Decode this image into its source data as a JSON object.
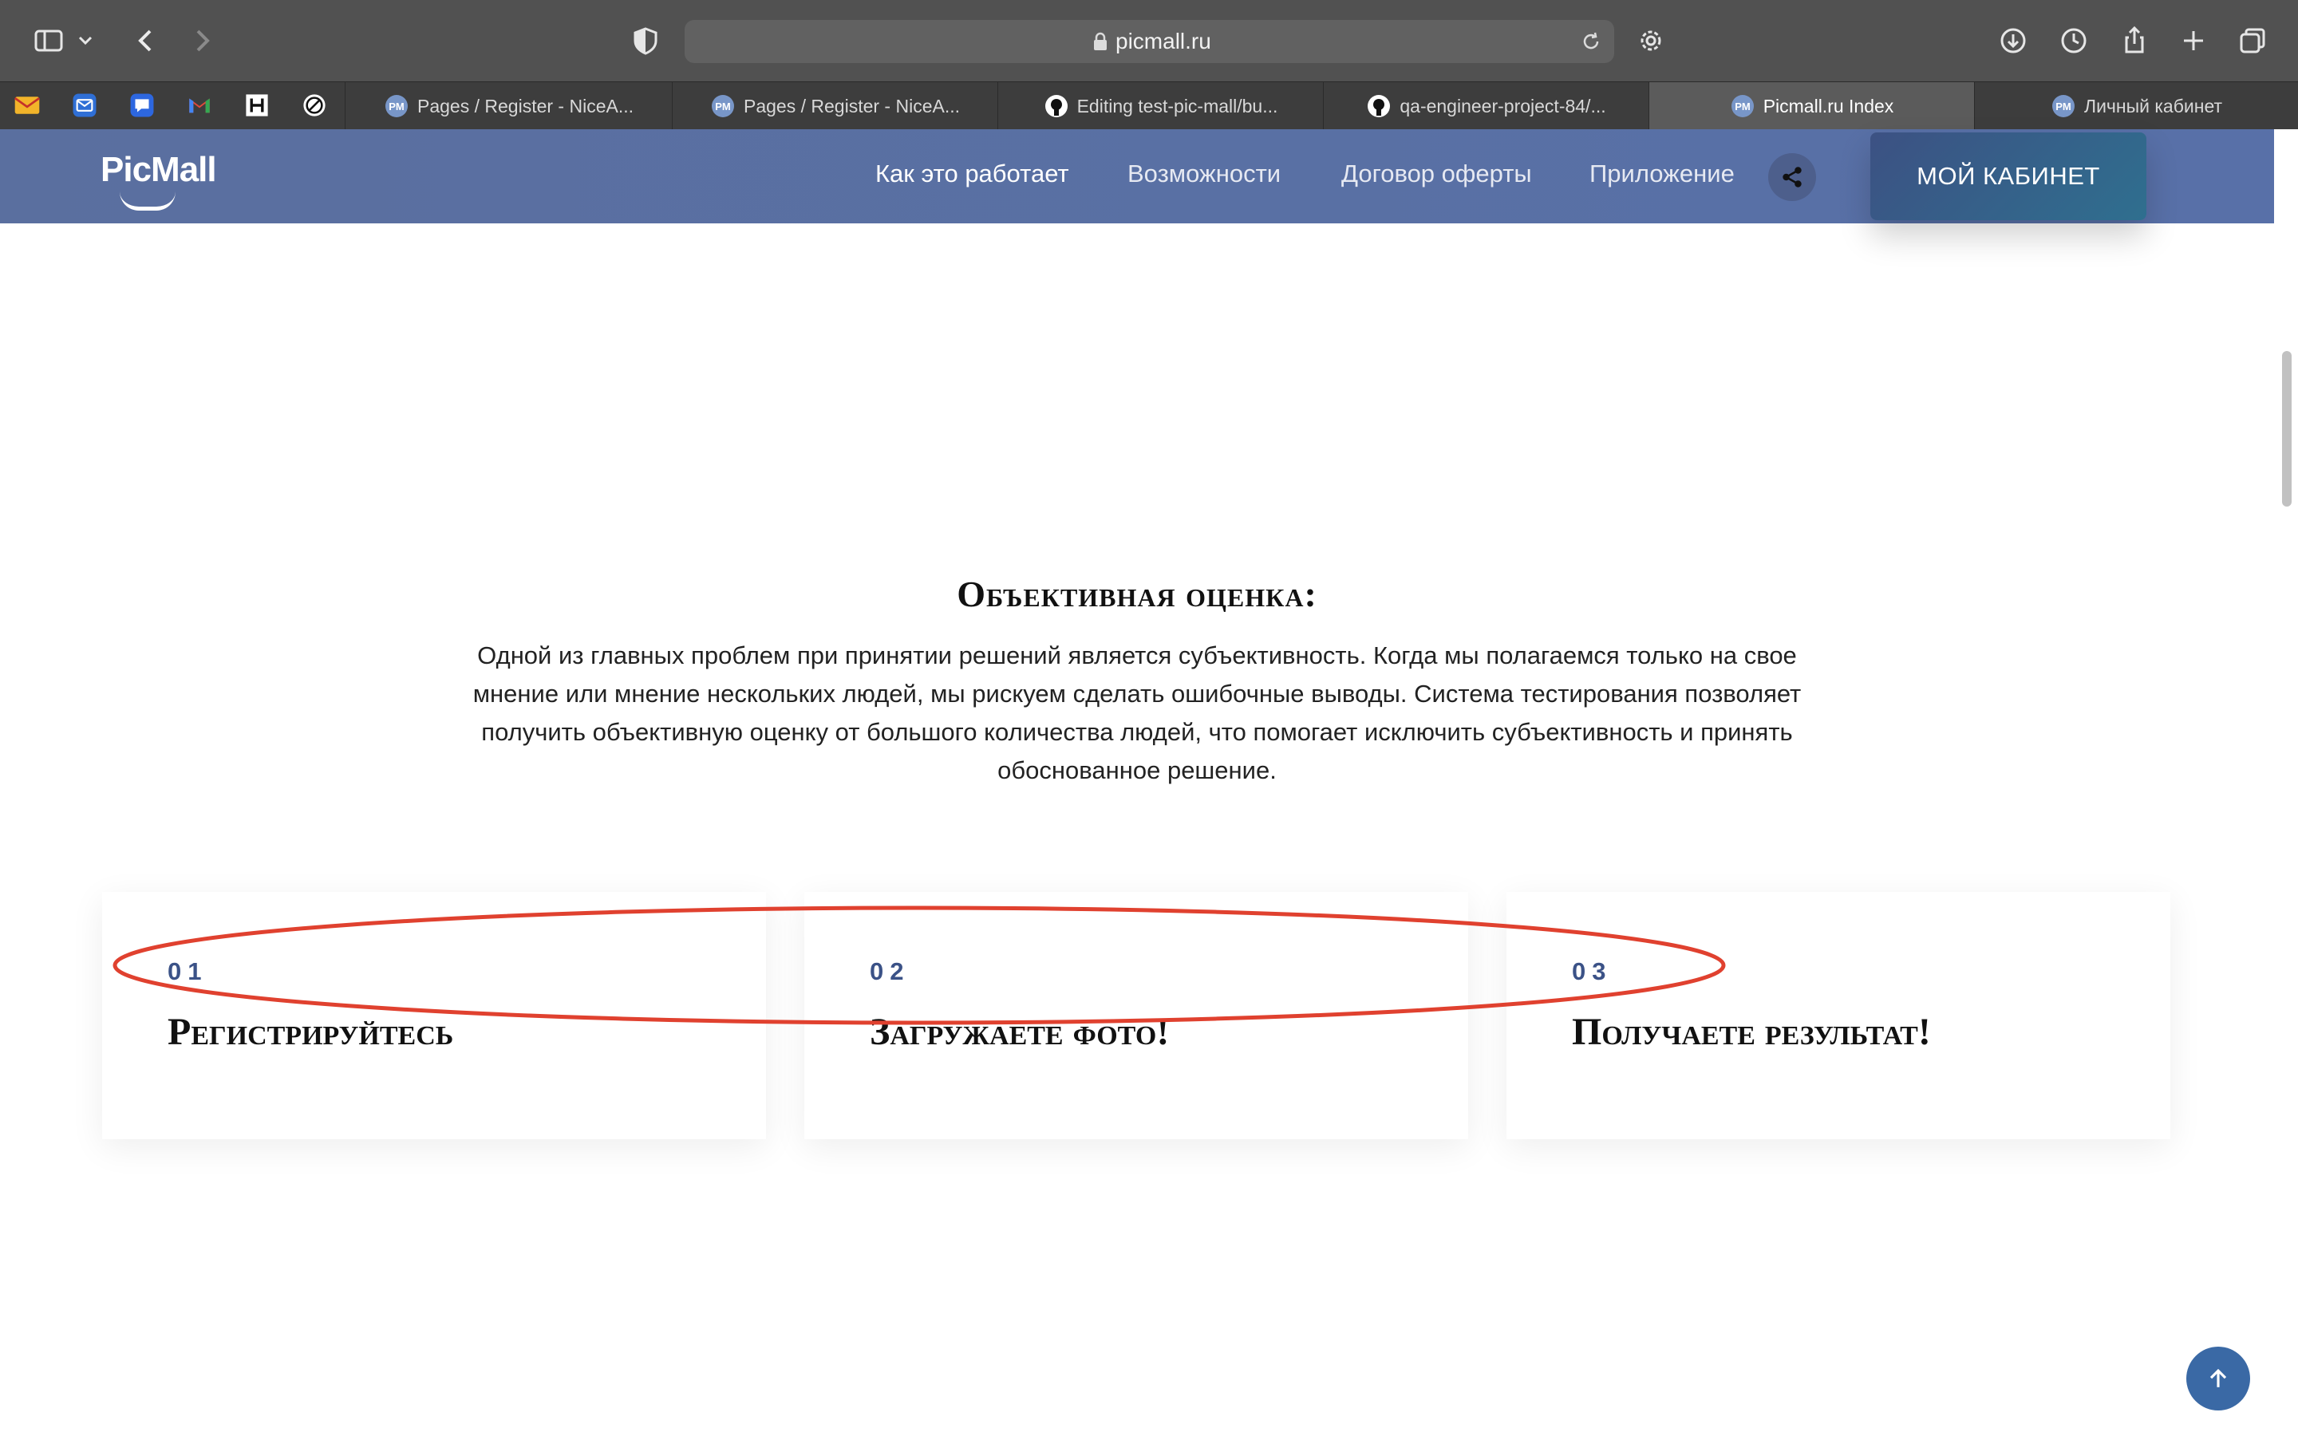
{
  "browser": {
    "url": "picmall.ru",
    "tabs": [
      {
        "title": "Pages / Register - NiceA..."
      },
      {
        "title": "Pages / Register - NiceA..."
      },
      {
        "title": "Editing test-pic-mall/bu..."
      },
      {
        "title": "qa-engineer-project-84/..."
      },
      {
        "title": "Picmall.ru Index",
        "active": true
      },
      {
        "title": "Личный кабинет"
      }
    ],
    "tab_favicon_text": "PM"
  },
  "site": {
    "logo": "PicMall",
    "nav": [
      {
        "label": "Как это работает",
        "active": true
      },
      {
        "label": "Возможности"
      },
      {
        "label": "Договор оферты"
      },
      {
        "label": "Приложение"
      }
    ],
    "cabinet_button": "МОЙ КАБИНЕТ"
  },
  "section": {
    "title": "Объективная оценка:",
    "text": "Одной из главных проблем при принятии решений является субъективность. Когда мы полагаемся только на свое мнение или мнение нескольких людей, мы рискуем сделать ошибочные выводы. Система тестирования позволяет получить объективную оценку от большого количества людей, что помогает исключить субъективность и принять обоснованное решение."
  },
  "steps": [
    {
      "number": "01",
      "title": "Регистрируйтесь"
    },
    {
      "number": "02",
      "title": "Загружаете фото!"
    },
    {
      "number": "03",
      "title": "Получаете результат!"
    }
  ],
  "colors": {
    "header": "#5a6f9f",
    "accent": "#3b5287",
    "annotation": "#e0412f"
  }
}
